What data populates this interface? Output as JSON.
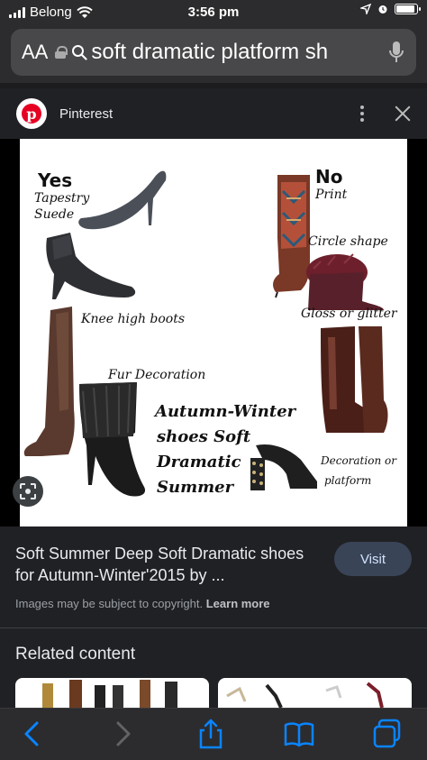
{
  "status_bar": {
    "carrier": "Belong",
    "time": "3:56 pm",
    "battery_level": 0.9
  },
  "address_bar": {
    "text_size_label": "AA",
    "url_text": "soft dramatic platform sh",
    "icons": [
      "lock-icon",
      "search-icon",
      "microphone-icon"
    ]
  },
  "source": {
    "name": "Pinterest",
    "logo_letter": "p"
  },
  "image": {
    "labels": {
      "yes": "Yes",
      "tapestry": "Tapestry",
      "suede": "Suede",
      "no": "No",
      "print": "Print",
      "circle_shape": "Circle shape",
      "gloss_or_glitter": "Gloss or glitter",
      "knee_high_boots": "Knee high boots",
      "fur_decoration": "Fur Decoration",
      "title_line1": "Autumn-Winter",
      "title_line2": "shoes Soft",
      "title_line3": "Dramatic",
      "title_line4": "Summer",
      "decoration_or": "Decoration or",
      "platform": "platform"
    }
  },
  "result": {
    "title": "Soft Summer Deep Soft Dramatic shoes for Autumn-Winter'2015 by ...",
    "visit_label": "Visit",
    "copyright_text": "Images may be subject to copyright.",
    "learn_more": "Learn more"
  },
  "related": {
    "title": "Related content"
  },
  "colors": {
    "background": "#202124",
    "accent": "#0a84ff",
    "pinterest_red": "#e60023",
    "visit_button": "#394457"
  }
}
